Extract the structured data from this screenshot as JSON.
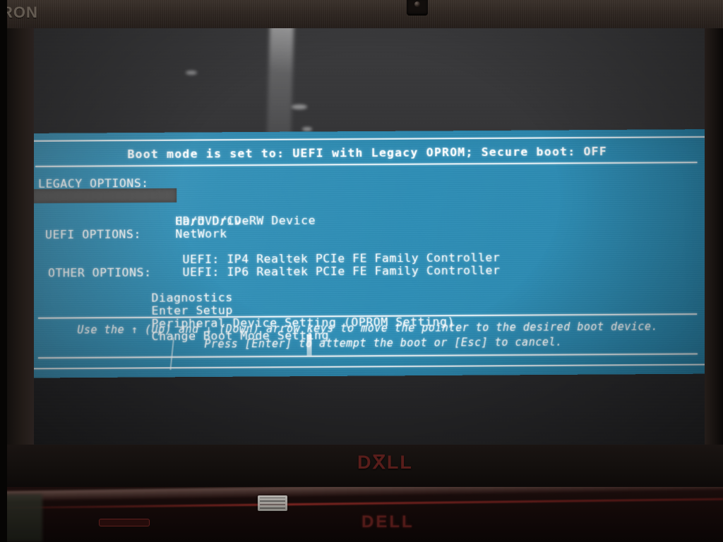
{
  "hardware": {
    "lid_brand_partial": "RON",
    "lid_logo": "DⴳLL",
    "deck_logo": "DELL",
    "webcam_label": "webcam"
  },
  "bios": {
    "title": "Boot mode is set to: UEFI with Legacy OPROM; Secure boot: OFF",
    "groups": [
      {
        "heading": "LEGACY OPTIONS:",
        "items": [
          {
            "label": "Hard Drive",
            "selected": true
          },
          {
            "label": "CD/DVD/CD-RW Device",
            "selected": false
          },
          {
            "label": "NetWork",
            "selected": false
          }
        ]
      },
      {
        "heading": "UEFI OPTIONS:",
        "items": [
          {
            "label": "UEFI: IP4 Realtek PCIe FE Family Controller",
            "selected": false
          },
          {
            "label": "UEFI: IP6 Realtek PCIe FE Family Controller",
            "selected": false
          }
        ]
      },
      {
        "heading": "OTHER OPTIONS:",
        "items": [
          {
            "label": "Diagnostics",
            "selected": false
          },
          {
            "label": "Enter Setup",
            "selected": false
          },
          {
            "label": "Peripheral Device Setting (OPROM Setting)",
            "selected": false
          },
          {
            "label": "Change Boot Mode Setting",
            "selected": false
          }
        ]
      }
    ],
    "help_line_1": "Use the ↑ (Up) and ↓ (Down) arrow keys to move the pointer to the desired boot device.",
    "help_line_2": "Press [Enter] to attempt the boot or [Esc] to cancel.",
    "selected_item": "Hard Drive"
  },
  "colors": {
    "bios_blue": "#2e8fb8",
    "bios_text": "#ffffff",
    "selection_bar": "#4e4e4e",
    "frame_white": "#eef7fb",
    "bezel_brown": "#2e2621",
    "dell_red": "#5e1f1c"
  }
}
